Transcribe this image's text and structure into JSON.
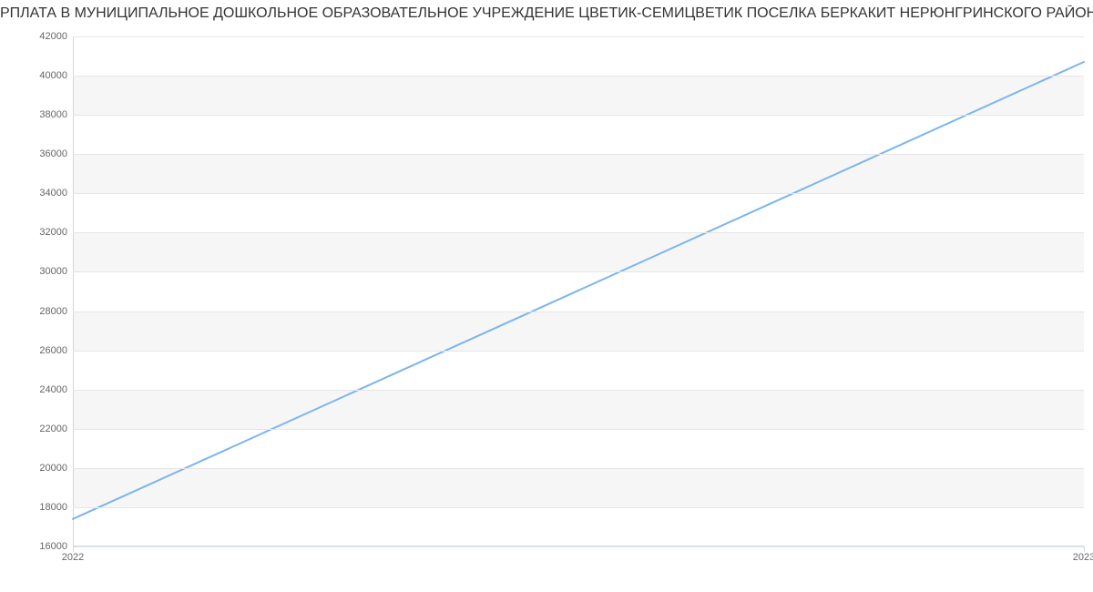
{
  "chart_data": {
    "type": "line",
    "title": "РПЛАТА В МУНИЦИПАЛЬНОЕ ДОШКОЛЬНОЕ ОБРАЗОВАТЕЛЬНОЕ УЧРЕЖДЕНИЕ ЦВЕТИК-СЕМИЦВЕТИК ПОСЕЛКА БЕРКАКИТ НЕРЮНГРИНСКОГО РАЙОНА | Данные mnogo.we",
    "categories": [
      "2022",
      "2023"
    ],
    "x": [
      2022,
      2023
    ],
    "values": [
      17400,
      40700
    ],
    "xlabel": "",
    "ylabel": "",
    "ylim": [
      16000,
      42000
    ],
    "yticks": [
      16000,
      18000,
      20000,
      22000,
      24000,
      26000,
      28000,
      30000,
      32000,
      34000,
      36000,
      38000,
      40000,
      42000
    ],
    "line_color": "#7cb5ec"
  }
}
